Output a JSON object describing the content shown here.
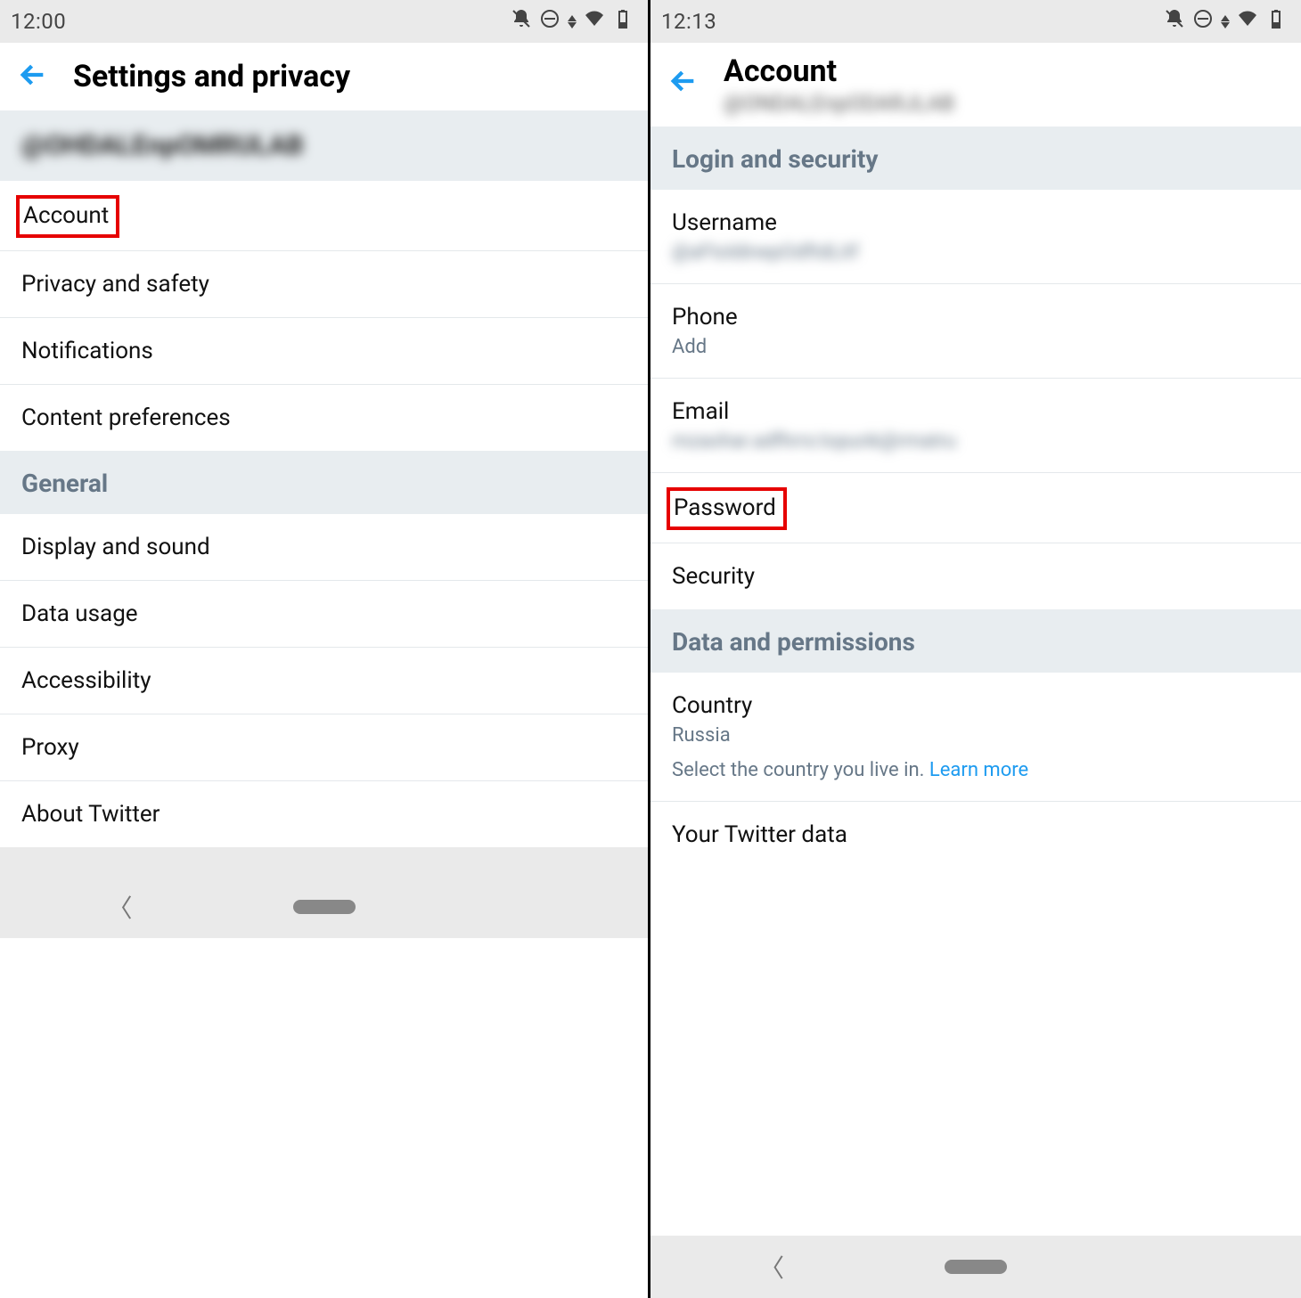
{
  "left": {
    "status_time": "12:00",
    "header_title": "Settings and privacy",
    "username_display": "@OHDALEnpOMRULAB",
    "items_top": [
      {
        "label": "Account",
        "highlighted": true
      },
      {
        "label": "Privacy and safety"
      },
      {
        "label": "Notifications"
      },
      {
        "label": "Content preferences"
      }
    ],
    "section_general": "General",
    "items_general": [
      {
        "label": "Display and sound"
      },
      {
        "label": "Data usage"
      },
      {
        "label": "Accessibility"
      },
      {
        "label": "Proxy"
      },
      {
        "label": "About Twitter"
      }
    ]
  },
  "right": {
    "status_time": "12:13",
    "header_title": "Account",
    "header_sub": "@ONDALEnpODARJLAB",
    "section_login": "Login and security",
    "username_label": "Username",
    "username_value": "@aFtoldinepOdftdLitf",
    "phone_label": "Phone",
    "phone_value": "Add",
    "email_label": "Email",
    "email_value": "mzaohar.adfhrrs:topunk@rmatru",
    "password_label": "Password",
    "security_label": "Security",
    "section_data": "Data and permissions",
    "country_label": "Country",
    "country_value": "Russia",
    "country_hint": "Select the country you live in.",
    "learn_more": "Learn more",
    "your_data_label": "Your Twitter data"
  }
}
